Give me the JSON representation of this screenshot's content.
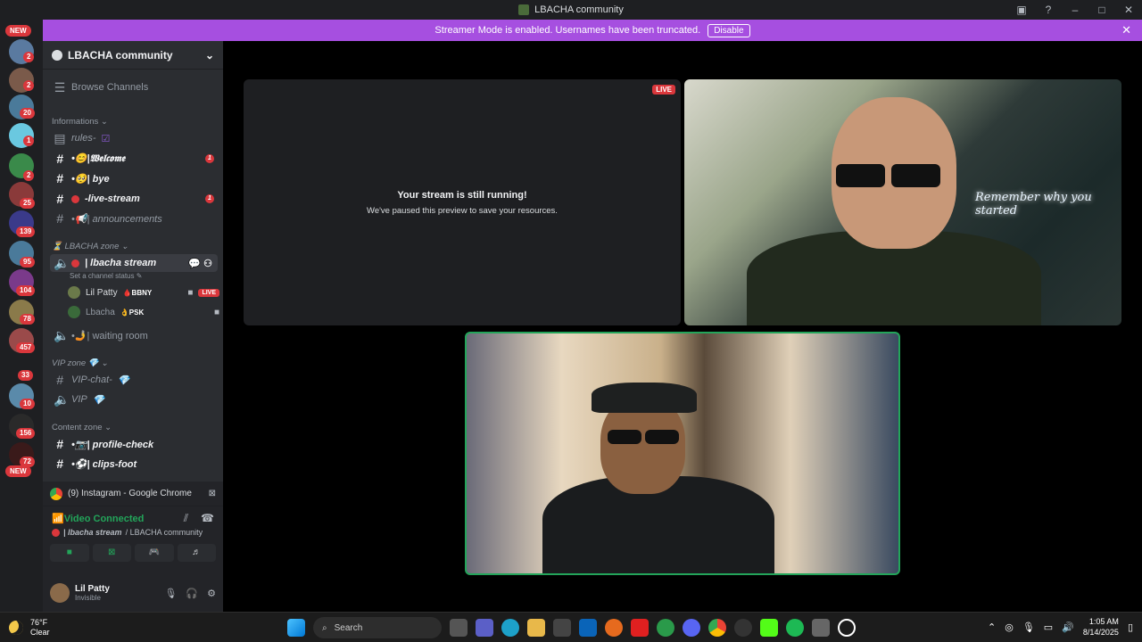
{
  "window": {
    "title": "LBACHA community"
  },
  "banner": {
    "text": "Streamer Mode is enabled. Usernames have been truncated.",
    "button": "Disable"
  },
  "servers": {
    "new_top": "NEW",
    "new_bottom": "NEW",
    "badges": [
      "2",
      "2",
      "20",
      "1",
      "2",
      "25",
      "139",
      "95",
      "104",
      "78",
      "457",
      "33",
      "10",
      "156",
      "72"
    ]
  },
  "guild": {
    "name": "LBACHA community"
  },
  "sidebar": {
    "browse": "Browse Channels",
    "cat_info": "Informations",
    "rules": "rules-",
    "welcome": "•😊|𝖂𝖊𝖑𝖈𝖔𝖒𝖊",
    "bye": "•🥺| bye",
    "live": "-live-stream",
    "announcements": "•📢| announcements",
    "cat_lbacha": "LBACHA zone",
    "lbacha_stream": "| lbacha stream",
    "status_hint": "Set a channel status",
    "user1": "Lil Patty",
    "user1_tag": "BBNY",
    "user1_live": "LIVE",
    "user2": "Lbacha",
    "user2_tag": "PSK",
    "waiting": "•🤳| waiting room",
    "cat_vip": "VIP zone",
    "vip_chat": "VIP-chat-",
    "vip": "VIP",
    "cat_content": "Content zone",
    "profile": "•📷| profile-check",
    "clips": "•⚽| clips-foot",
    "unread": "1"
  },
  "panel": {
    "stream_app": "(9) Instagram - Google Chrome",
    "vc_status": "Video Connected",
    "vc_channel": "| lbacha stream",
    "vc_guild": "/ LBACHA community",
    "user": "Lil Patty",
    "user_status": "Invisible"
  },
  "stage": {
    "paused_title": "Your stream is still running!",
    "paused_sub": "We've paused this preview to save your resources.",
    "live": "LIVE",
    "neon": "Remember why you started"
  },
  "taskbar": {
    "temp": "76°F",
    "weather": "Clear",
    "search": "Search",
    "time": "1:05 AM",
    "date": "8/14/2025"
  }
}
